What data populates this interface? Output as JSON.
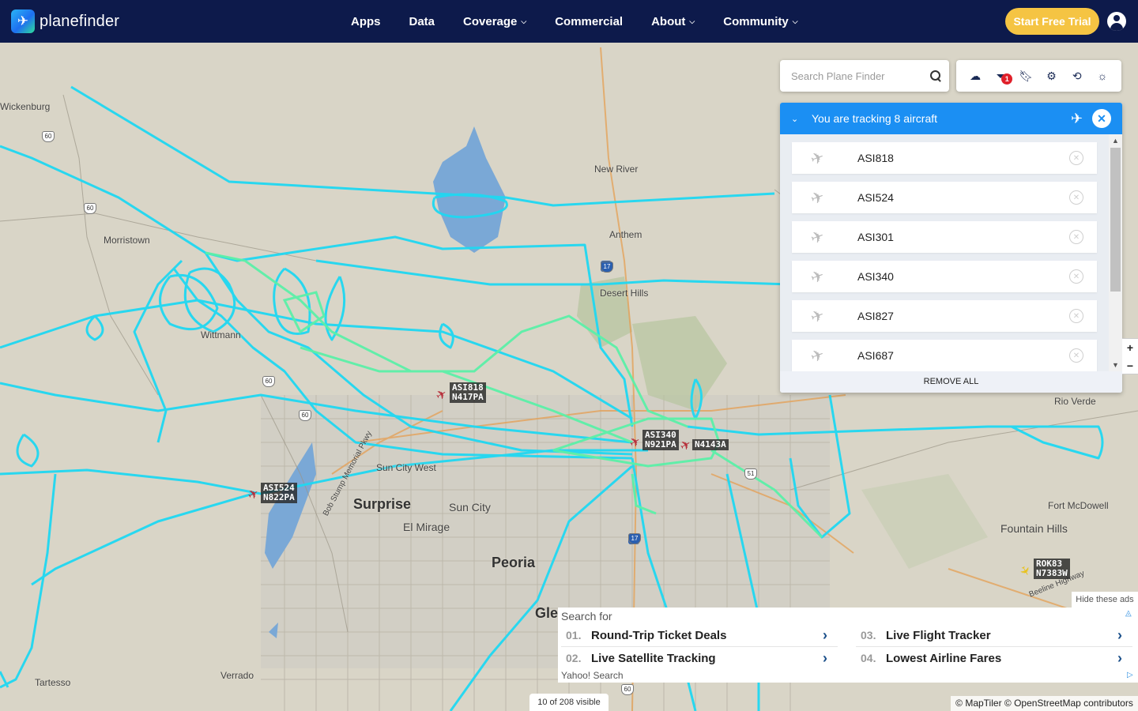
{
  "brand": {
    "name": "planefinder",
    "logo_icon": "plane-logo-icon"
  },
  "nav": [
    {
      "label": "Apps",
      "dropdown": false
    },
    {
      "label": "Data",
      "dropdown": false
    },
    {
      "label": "Coverage",
      "dropdown": true
    },
    {
      "label": "Commercial",
      "dropdown": false
    },
    {
      "label": "About",
      "dropdown": true
    },
    {
      "label": "Community",
      "dropdown": true
    }
  ],
  "header": {
    "trial_label": "Start Free Trial"
  },
  "search": {
    "placeholder": "Search Plane Finder"
  },
  "toolbar": {
    "filter_badge": "1"
  },
  "tracking": {
    "title": "You are tracking 8 aircraft",
    "remove_all": "REMOVE ALL",
    "aircraft": [
      "ASI818",
      "ASI524",
      "ASI301",
      "ASI340",
      "ASI827",
      "ASI687"
    ]
  },
  "map": {
    "places": [
      {
        "label": "Wickenburg"
      },
      {
        "label": "Morristown"
      },
      {
        "label": "Wittmann"
      },
      {
        "label": "New River"
      },
      {
        "label": "Anthem"
      },
      {
        "label": "Desert Hills"
      },
      {
        "label": "Surprise"
      },
      {
        "label": "Sun City West"
      },
      {
        "label": "Sun City"
      },
      {
        "label": "El Mirage"
      },
      {
        "label": "Peoria"
      },
      {
        "label": "Gle"
      },
      {
        "label": "Rio Verde"
      },
      {
        "label": "Fort McDowell"
      },
      {
        "label": "Fountain Hills"
      },
      {
        "label": "Tartesso"
      },
      {
        "label": "Verrado"
      },
      {
        "label": "Bob Stump Memorial Pkwy"
      },
      {
        "label": "Beeline Highway"
      }
    ],
    "shields": [
      "60",
      "60",
      "60",
      "60",
      "17",
      "17",
      "51",
      "60"
    ],
    "aircraft_labels": [
      {
        "callsign": "ASI818",
        "reg": "N417PA"
      },
      {
        "callsign": "ASI524",
        "reg": "N822PA"
      },
      {
        "callsign": "ASI340",
        "reg": "N921PA"
      },
      {
        "callsign": "",
        "reg": "N4143A"
      },
      {
        "callsign": "ROK83",
        "reg": "N7383W"
      }
    ]
  },
  "ads": {
    "hide_label": "Hide these ads",
    "search_for": "Search for",
    "items": [
      {
        "num": "01.",
        "text": "Round-Trip Ticket Deals"
      },
      {
        "num": "02.",
        "text": "Live Satellite Tracking"
      },
      {
        "num": "03.",
        "text": "Live Flight Tracker"
      },
      {
        "num": "04.",
        "text": "Lowest Airline Fares"
      }
    ],
    "provider": "Yahoo! Search"
  },
  "status": {
    "visible_count": "10 of 208 visible",
    "attribution": "© MapTiler © OpenStreetMap contributors"
  },
  "colors": {
    "header_bg": "#0d1a4b",
    "trial_bg": "#f5c443",
    "panel_header": "#1b8ff3",
    "track_cyan": "#1fd8f2",
    "track_green": "#5cf0a8"
  }
}
